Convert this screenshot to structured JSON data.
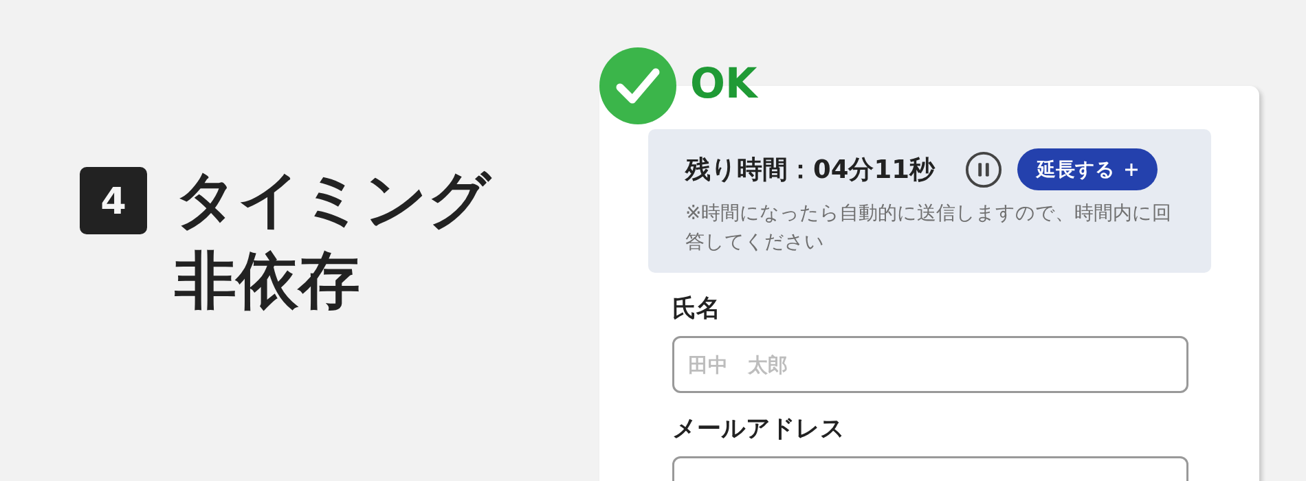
{
  "badge": {
    "number": "4"
  },
  "heading": {
    "lines": [
      "タイミング",
      "非依存"
    ]
  },
  "verdict": {
    "kind": "ok",
    "label": "OK"
  },
  "form": {
    "timer": {
      "remaining": "残り時間：04分11秒",
      "extend_button": "延長する",
      "note": "※時間になったら自動的に送信しますので、時間内に回答してください"
    },
    "fields": [
      {
        "label": "氏名",
        "placeholder": "田中　太郎"
      },
      {
        "label": "メールアドレス"
      }
    ]
  }
}
